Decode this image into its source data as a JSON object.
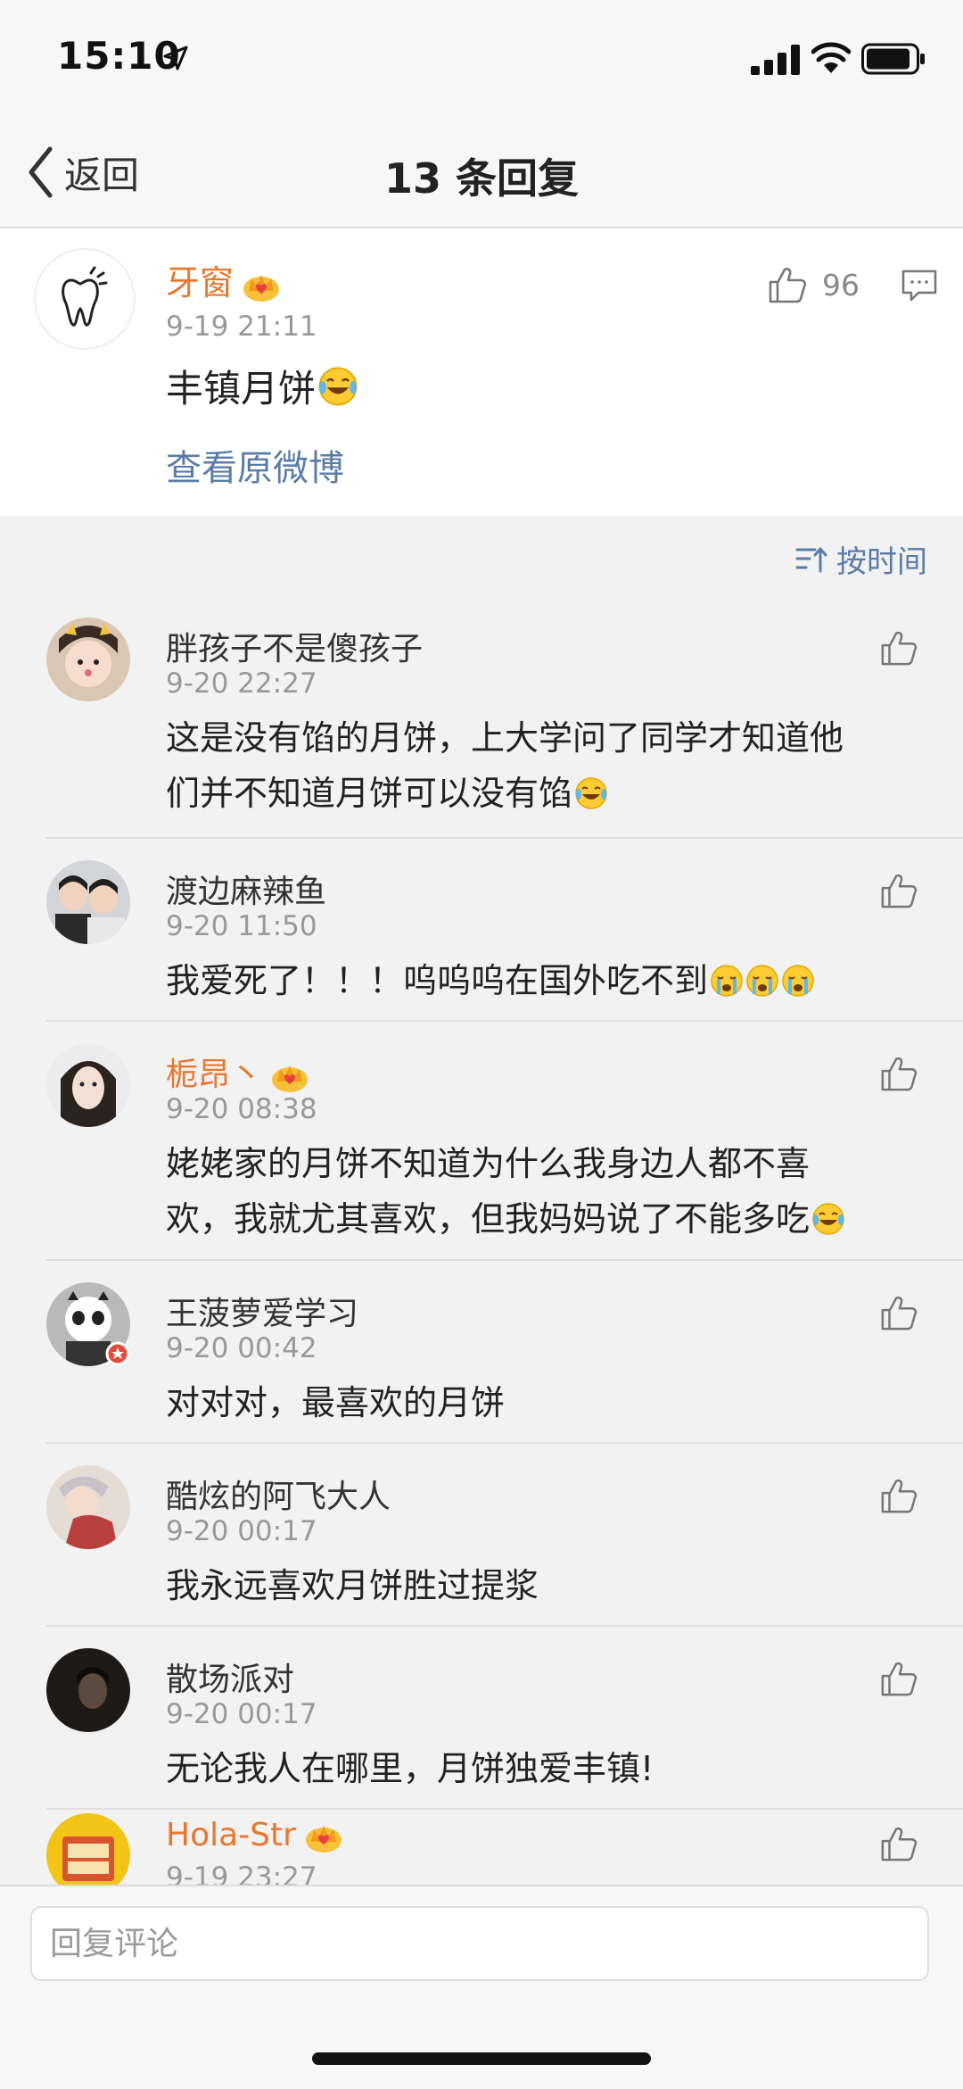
{
  "status_bar": {
    "time": "15:10"
  },
  "nav": {
    "back_label": "返回",
    "title": "13 条回复"
  },
  "post": {
    "author": "牙窗",
    "time": "9-19 21:11",
    "text": "丰镇月饼",
    "like_count": "96",
    "view_original": "查看原微博"
  },
  "sort": {
    "label": "按时间"
  },
  "comments": [
    {
      "name": "胖孩子不是傻孩子",
      "vip": false,
      "time": "9-20 22:27",
      "lines": [
        "这是没有馅的月饼，上大学问了同学才知道他",
        "们并不知道月饼可以没有馅"
      ],
      "emoji": [
        "laugh-cry"
      ]
    },
    {
      "name": "渡边麻辣鱼",
      "vip": false,
      "time": "9-20 11:50",
      "lines": [
        "我爱死了！！！呜呜呜在国外吃不到"
      ],
      "emoji": [
        "crying",
        "crying",
        "crying"
      ]
    },
    {
      "name": "栀昂丶",
      "vip": true,
      "time": "9-20 08:38",
      "lines": [
        "姥姥家的月饼不知道为什么我身边人都不喜",
        "欢，我就尤其喜欢，但我妈妈说了不能多吃"
      ],
      "emoji": [
        "laugh-cry"
      ]
    },
    {
      "name": "王菠萝爱学习",
      "vip": false,
      "time": "9-20 00:42",
      "lines": [
        "对对对，最喜欢的月饼"
      ],
      "emoji": []
    },
    {
      "name": "酷炫的阿飞大人",
      "vip": false,
      "time": "9-20 00:17",
      "lines": [
        "我永远喜欢月饼胜过提浆"
      ],
      "emoji": []
    },
    {
      "name": "散场派对",
      "vip": false,
      "time": "9-20 00:17",
      "lines": [
        "无论我人在哪里，月饼独爱丰镇!"
      ],
      "emoji": []
    },
    {
      "name": "Hola-Str",
      "vip": true,
      "time": "9-19 23:27",
      "lines": [],
      "emoji": []
    }
  ],
  "reply": {
    "placeholder": "回复评论"
  },
  "colors": {
    "vip_name": "#e8772e",
    "link": "#5a7ca8",
    "meta": "#999999",
    "background": "#f2f2f2"
  },
  "icons": [
    "location-arrow-icon",
    "signal-icon",
    "wifi-icon",
    "battery-icon",
    "back-chevron-icon",
    "crown-badge-icon",
    "thumbs-up-icon",
    "comment-icon",
    "sort-icon",
    "laugh-cry-emoji",
    "crying-emoji"
  ]
}
